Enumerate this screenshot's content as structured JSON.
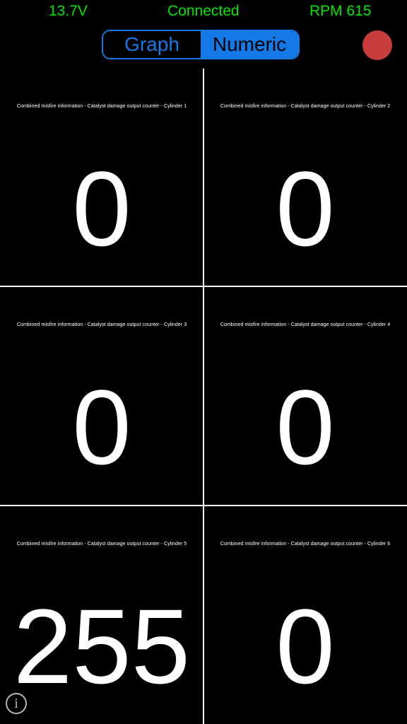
{
  "header": {
    "voltage": "13.7V",
    "connection_status": "Connected",
    "rpm": "RPM 615"
  },
  "view_toggle": {
    "graph_label": "Graph",
    "numeric_label": "Numeric",
    "selected": "Numeric"
  },
  "record": {
    "icon": "record-icon"
  },
  "cells": [
    {
      "label": "Combined misfire information  -  Catalyst damage output counter  -  Cylinder 1",
      "value": "0"
    },
    {
      "label": "Combined misfire information  -  Catalyst damage output counter  -  Cylinder 2",
      "value": "0"
    },
    {
      "label": "Combined misfire information  -  Catalyst damage output counter  -  Cylinder 3",
      "value": "0"
    },
    {
      "label": "Combined misfire information  -  Catalyst damage output counter  -  Cylinder 4",
      "value": "0"
    },
    {
      "label": "Combined misfire information  -  Catalyst damage output counter  -  Cylinder 5",
      "value": "255"
    },
    {
      "label": "Combined misfire information  -  Catalyst damage output counter  -  Cylinder 6",
      "value": "0"
    }
  ],
  "info": {
    "icon": "info-icon",
    "glyph": "i"
  },
  "colors": {
    "status_text": "#00e600",
    "toggle_accent": "#1478e6",
    "record_button": "#c83c3c",
    "background": "#000000",
    "foreground": "#ffffff"
  }
}
